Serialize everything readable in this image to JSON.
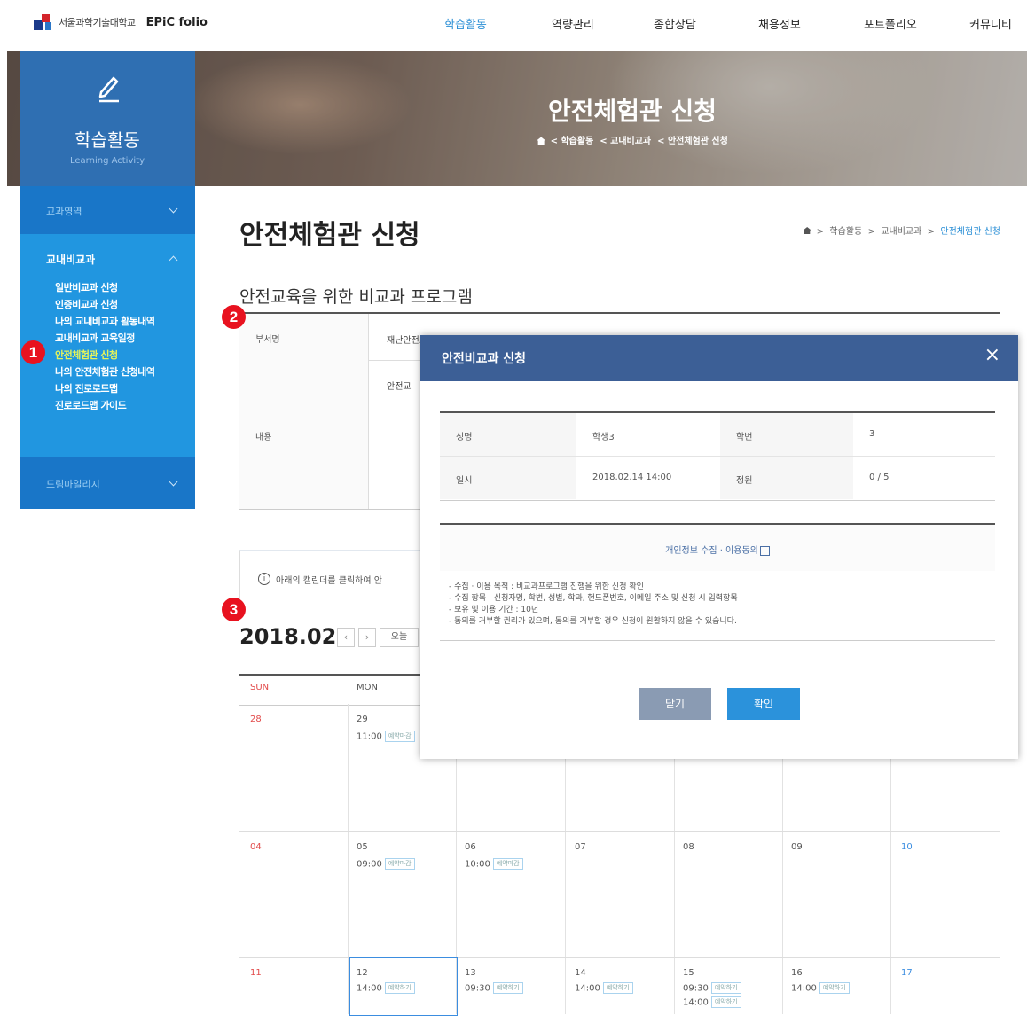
{
  "header": {
    "univ": "서울과학기술대학교",
    "app": "EPiC folio",
    "nav": [
      "학습활동",
      "역량관리",
      "종합상담",
      "채용정보",
      "포트폴리오",
      "커뮤니티"
    ]
  },
  "hero": {
    "title": "안전체험관 신청",
    "crumb": [
      "학습활동",
      "교내비교과",
      "안전체험관 신청"
    ]
  },
  "sidebar": {
    "title": "학습활동",
    "subtitle": "Learning Activity",
    "sec1": "교과영역",
    "sec2": "교내비교과",
    "items": [
      "일반비교과 신청",
      "인증비교과 신청",
      "나의 교내비교과 활동내역",
      "교내비교과 교육일정",
      "안전체험관 신청",
      "나의 안전체험관 신청내역",
      "나의 진로로드맵",
      "진로로드맵 가이드"
    ],
    "sec3": "드림마일리지"
  },
  "badges": [
    "1",
    "2",
    "3"
  ],
  "main": {
    "title": "안전체험관 신청",
    "crumb": [
      "학습활동",
      "교내비교과",
      "안전체험관 신청"
    ],
    "section_title": "안전교육을 위한 비교과 프로그램",
    "table": {
      "dept_label": "부서명",
      "dept_value": "재난안전교육원",
      "content_label": "내용",
      "content_value": "안전교"
    },
    "notice": "아래의 캘린더를 클릭하여 안"
  },
  "calendar": {
    "title": "2018.02",
    "prev": "‹",
    "next": "›",
    "today": "오늘",
    "days": [
      "SUN",
      "MON"
    ],
    "row1": {
      "sun": "28",
      "mon": "29",
      "mon_time": "11:00",
      "mon_tag": "예약마감"
    },
    "row2": [
      {
        "day": "04"
      },
      {
        "day": "05",
        "time": "09:00",
        "tag": "예약마감"
      },
      {
        "day": "06",
        "time": "10:00",
        "tag": "예약마감"
      },
      {
        "day": "07"
      },
      {
        "day": "08"
      },
      {
        "day": "09"
      },
      {
        "day": "10"
      }
    ],
    "row3": [
      {
        "day": "11"
      },
      {
        "day": "12",
        "time": "14:00",
        "tag": "예약하기"
      },
      {
        "day": "13",
        "time": "09:30",
        "tag": "예약하기"
      },
      {
        "day": "14",
        "time": "14:00",
        "tag": "예약하기"
      },
      {
        "day": "15",
        "time": "09:30",
        "tag": "예약하기",
        "time2": "14:00",
        "tag2": "예약하기"
      },
      {
        "day": "16",
        "time": "14:00",
        "tag": "예약하기"
      },
      {
        "day": "17"
      }
    ]
  },
  "modal": {
    "title": "안전비교과 신청",
    "close_icon": "×",
    "name_label": "성명",
    "name_value": "학생3",
    "id_label": "학번",
    "id_value": "3",
    "date_label": "일시",
    "date_value": "2018.02.14 14:00",
    "capacity_label": "정원",
    "capacity_value": "0 / 5",
    "privacy": "개인정보 수집 · 이용동의",
    "terms": [
      "- 수집 · 이용 목적 : 비교과프로그램 진행을 위한 신청 확인",
      "- 수집 항목 : 신청자명, 학번, 성별, 학과, 핸드폰번호, 이메일 주소 및 신청 시 입력항목",
      "- 보유 및 이용 기간 : 10년",
      "- 동의를 거부할 권리가 있으며, 동의를 거부할 경우 신청이 원활하지 않을 수 있습니다."
    ],
    "btn_close": "닫기",
    "btn_ok": "확인"
  },
  "colors": {
    "accent": "#2b8fd6",
    "sidebar": "#2196e0",
    "modal_header": "#3c5f96",
    "badge": "#e8121f"
  }
}
